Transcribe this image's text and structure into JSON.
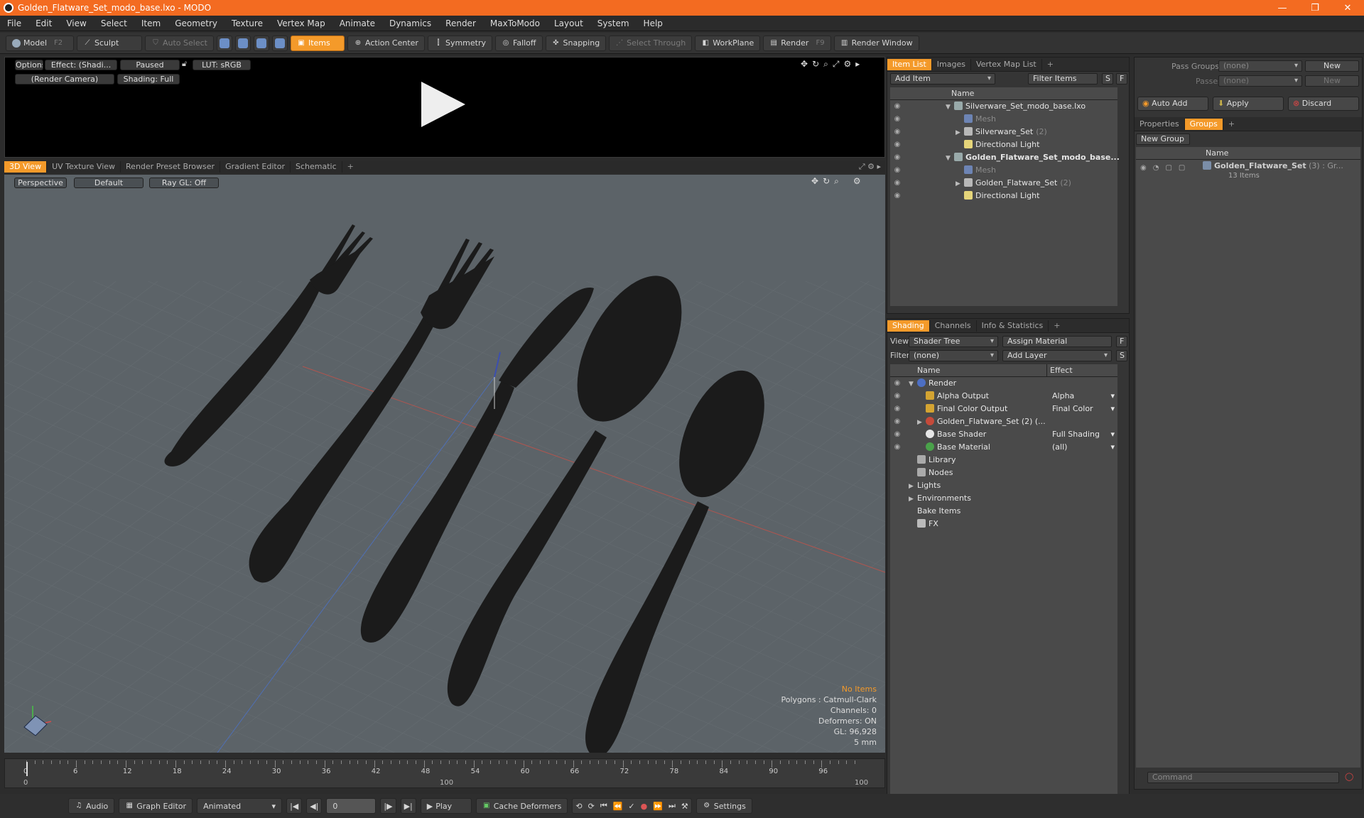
{
  "window": {
    "title": "Golden_Flatware_Set_modo_base.lxo - MODO"
  },
  "menu": [
    "File",
    "Edit",
    "View",
    "Select",
    "Item",
    "Geometry",
    "Texture",
    "Vertex Map",
    "Animate",
    "Dynamics",
    "Render",
    "MaxToModo",
    "Layout",
    "System",
    "Help"
  ],
  "toolbar": {
    "model": "Model",
    "model_key": "F2",
    "sculpt": "Sculpt",
    "auto_select": "Auto Select",
    "items": "Items",
    "action_center": "Action Center",
    "symmetry": "Symmetry",
    "falloff": "Falloff",
    "snapping": "Snapping",
    "select_through": "Select Through",
    "workplane": "WorkPlane",
    "render": "Render",
    "render_key": "F9",
    "render_window": "Render Window"
  },
  "preview": {
    "options": "Options",
    "effect": "Effect: (Shadi...",
    "paused": "Paused",
    "lut": "LUT: sRGB",
    "camera": "(Render Camera)",
    "shading": "Shading: Full"
  },
  "viewtabs": [
    "3D View",
    "UV Texture View",
    "Render Preset Browser",
    "Gradient Editor",
    "Schematic",
    "+"
  ],
  "viewport": {
    "projection": "Perspective",
    "style": "Default",
    "raygl": "Ray GL: Off",
    "info": {
      "no_items": "No Items",
      "polygons": "Polygons : Catmull-Clark",
      "channels": "Channels: 0",
      "deformers": "Deformers: ON",
      "gl": "GL: 96,928",
      "unit": "5 mm"
    }
  },
  "timeline": {
    "ticks": [
      "0",
      "6",
      "12",
      "18",
      "24",
      "30",
      "36",
      "42",
      "48",
      "54",
      "60",
      "66",
      "72",
      "78",
      "84",
      "90",
      "96"
    ],
    "start": "0",
    "mid": "100",
    "end": "100"
  },
  "bottombar": {
    "audio": "Audio",
    "graph_editor": "Graph Editor",
    "animated": "Animated",
    "frame": "0",
    "play": "Play",
    "cache": "Cache Deformers",
    "settings": "Settings"
  },
  "itemlist": {
    "tabs": [
      "Item List",
      "Images",
      "Vertex Map List",
      "+"
    ],
    "add_item": "Add Item",
    "filter_items": "Filter Items",
    "s": "S",
    "f": "F",
    "col_name": "Name",
    "rows": [
      {
        "label": "Silverware_Set_modo_base.lxo",
        "sub": "",
        "kind": "scene",
        "bold": false,
        "indent": 0,
        "arrow": "▼"
      },
      {
        "label": "Mesh",
        "sub": "",
        "kind": "mesh",
        "bold": false,
        "indent": 1,
        "arrow": ""
      },
      {
        "label": "Silverware_Set",
        "sub": "(2)",
        "kind": "group",
        "bold": false,
        "indent": 1,
        "arrow": "▶"
      },
      {
        "label": "Directional Light",
        "sub": "",
        "kind": "light",
        "bold": false,
        "indent": 1,
        "arrow": ""
      },
      {
        "label": "Golden_Flatware_Set_modo_base...",
        "sub": "",
        "kind": "scene",
        "bold": true,
        "indent": 0,
        "arrow": "▼"
      },
      {
        "label": "Mesh",
        "sub": "",
        "kind": "mesh",
        "bold": false,
        "indent": 1,
        "arrow": ""
      },
      {
        "label": "Golden_Flatware_Set",
        "sub": "(2)",
        "kind": "group",
        "bold": false,
        "indent": 1,
        "arrow": "▶"
      },
      {
        "label": "Directional Light",
        "sub": "",
        "kind": "light",
        "bold": false,
        "indent": 1,
        "arrow": ""
      }
    ]
  },
  "shading": {
    "tabs": [
      "Shading",
      "Channels",
      "Info & Statistics",
      "+"
    ],
    "view_label": "View",
    "view_value": "Shader Tree",
    "assign_material": "Assign Material",
    "filter_label": "Filter",
    "filter_value": "(none)",
    "add_layer": "Add Layer",
    "f": "F",
    "s": "S",
    "col_name": "Name",
    "col_effect": "Effect",
    "rows": [
      {
        "label": "Render",
        "effect": "",
        "icon": "render",
        "indent": 0,
        "arrow": "▼"
      },
      {
        "label": "Alpha Output",
        "effect": "Alpha",
        "icon": "output",
        "indent": 1,
        "arrow": ""
      },
      {
        "label": "Final Color Output",
        "effect": "Final Color",
        "icon": "output",
        "indent": 1,
        "arrow": ""
      },
      {
        "label": "Golden_Flatware_Set (2) (...",
        "effect": "",
        "icon": "mat",
        "indent": 1,
        "arrow": "▶"
      },
      {
        "label": "Base Shader",
        "effect": "Full Shading",
        "icon": "shader",
        "indent": 1,
        "arrow": ""
      },
      {
        "label": "Base Material",
        "effect": "(all)",
        "icon": "basemat",
        "indent": 1,
        "arrow": ""
      },
      {
        "label": "Library",
        "effect": "",
        "icon": "folder",
        "indent": 0,
        "arrow": ""
      },
      {
        "label": "Nodes",
        "effect": "",
        "icon": "folder",
        "indent": 0,
        "arrow": ""
      },
      {
        "label": "Lights",
        "effect": "",
        "icon": "",
        "indent": 0,
        "arrow": "▶"
      },
      {
        "label": "Environments",
        "effect": "",
        "icon": "",
        "indent": 0,
        "arrow": "▶"
      },
      {
        "label": "Bake Items",
        "effect": "",
        "icon": "",
        "indent": 0,
        "arrow": ""
      },
      {
        "label": "FX",
        "effect": "",
        "icon": "fx",
        "indent": 0,
        "arrow": ""
      }
    ]
  },
  "passes": {
    "pass_groups": "Pass Groups",
    "pass_groups_value": "(none)",
    "new": "New",
    "passes": "Passes",
    "passes_value": "(none)",
    "new2": "New",
    "auto_add": "Auto Add",
    "apply": "Apply",
    "discard": "Discard"
  },
  "groups": {
    "tabs": [
      "Properties",
      "Groups",
      "+"
    ],
    "new_group": "New Group",
    "col_name": "Name",
    "item_label": "Golden_Flatware_Set",
    "item_sub": "(3) : Gr...",
    "item_count": "13 Items"
  },
  "command": {
    "placeholder": "Command"
  },
  "colors": {
    "accent": "#f49a2a",
    "title": "#f36b21"
  }
}
